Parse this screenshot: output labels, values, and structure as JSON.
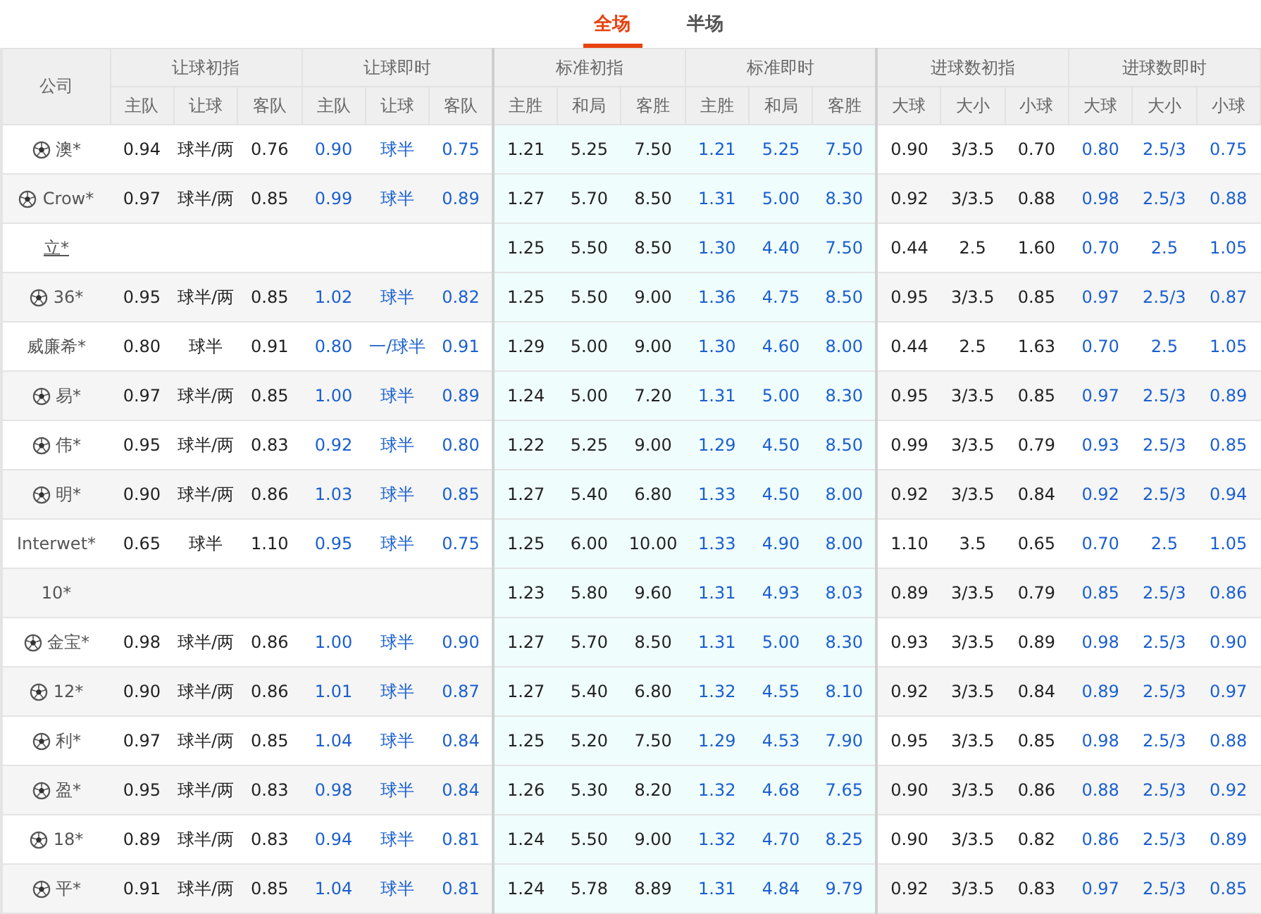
{
  "tabs": [
    {
      "label": "全场",
      "selected": true
    },
    {
      "label": "半场",
      "selected": false
    }
  ],
  "table": {
    "company_header": "公司",
    "groups": [
      {
        "title": "让球初指",
        "live": false,
        "shaded": false,
        "columns": [
          "主队",
          "让球",
          "客队"
        ]
      },
      {
        "title": "让球即时",
        "live": true,
        "shaded": false,
        "columns": [
          "主队",
          "让球",
          "客队"
        ]
      },
      {
        "title": "标准初指",
        "live": false,
        "shaded": true,
        "columns": [
          "主胜",
          "和局",
          "客胜"
        ]
      },
      {
        "title": "标准即时",
        "live": true,
        "shaded": true,
        "columns": [
          "主胜",
          "和局",
          "客胜"
        ]
      },
      {
        "title": "进球数初指",
        "live": false,
        "shaded": false,
        "columns": [
          "大球",
          "大小",
          "小球"
        ]
      },
      {
        "title": "进球数即时",
        "live": true,
        "shaded": false,
        "columns": [
          "大球",
          "大小",
          "小球"
        ]
      }
    ],
    "rows": [
      {
        "company": "澳*",
        "ball": true,
        "link": false,
        "handicap_open": [
          "0.94",
          "球半/两",
          "0.76"
        ],
        "handicap_live": [
          "0.90",
          "球半",
          "0.75"
        ],
        "standard_open": [
          "1.21",
          "5.25",
          "7.50"
        ],
        "standard_live": [
          "1.21",
          "5.25",
          "7.50"
        ],
        "goals_open": [
          "0.90",
          "3/3.5",
          "0.70"
        ],
        "goals_live": [
          "0.80",
          "2.5/3",
          "0.75"
        ]
      },
      {
        "company": "Crow*",
        "ball": true,
        "link": false,
        "handicap_open": [
          "0.97",
          "球半/两",
          "0.85"
        ],
        "handicap_live": [
          "0.99",
          "球半",
          "0.89"
        ],
        "standard_open": [
          "1.27",
          "5.70",
          "8.50"
        ],
        "standard_live": [
          "1.31",
          "5.00",
          "8.30"
        ],
        "goals_open": [
          "0.92",
          "3/3.5",
          "0.88"
        ],
        "goals_live": [
          "0.98",
          "2.5/3",
          "0.88"
        ]
      },
      {
        "company": "立*",
        "ball": false,
        "link": true,
        "standard_open": [
          "1.25",
          "5.50",
          "8.50"
        ],
        "standard_live": [
          "1.30",
          "4.40",
          "7.50"
        ],
        "goals_open": [
          "0.44",
          "2.5",
          "1.60"
        ],
        "goals_live": [
          "0.70",
          "2.5",
          "1.05"
        ]
      },
      {
        "company": "36*",
        "ball": true,
        "link": false,
        "handicap_open": [
          "0.95",
          "球半/两",
          "0.85"
        ],
        "handicap_live": [
          "1.02",
          "球半",
          "0.82"
        ],
        "standard_open": [
          "1.25",
          "5.50",
          "9.00"
        ],
        "standard_live": [
          "1.36",
          "4.75",
          "8.50"
        ],
        "goals_open": [
          "0.95",
          "3/3.5",
          "0.85"
        ],
        "goals_live": [
          "0.97",
          "2.5/3",
          "0.87"
        ]
      },
      {
        "company": "威廉希*",
        "ball": false,
        "link": false,
        "handicap_open": [
          "0.80",
          "球半",
          "0.91"
        ],
        "handicap_live": [
          "0.80",
          "一/球半",
          "0.91"
        ],
        "standard_open": [
          "1.29",
          "5.00",
          "9.00"
        ],
        "standard_live": [
          "1.30",
          "4.60",
          "8.00"
        ],
        "goals_open": [
          "0.44",
          "2.5",
          "1.63"
        ],
        "goals_live": [
          "0.70",
          "2.5",
          "1.05"
        ]
      },
      {
        "company": "易*",
        "ball": true,
        "link": false,
        "handicap_open": [
          "0.97",
          "球半/两",
          "0.85"
        ],
        "handicap_live": [
          "1.00",
          "球半",
          "0.89"
        ],
        "standard_open": [
          "1.24",
          "5.00",
          "7.20"
        ],
        "standard_live": [
          "1.31",
          "5.00",
          "8.30"
        ],
        "goals_open": [
          "0.95",
          "3/3.5",
          "0.85"
        ],
        "goals_live": [
          "0.97",
          "2.5/3",
          "0.89"
        ]
      },
      {
        "company": "伟*",
        "ball": true,
        "link": false,
        "handicap_open": [
          "0.95",
          "球半/两",
          "0.83"
        ],
        "handicap_live": [
          "0.92",
          "球半",
          "0.80"
        ],
        "standard_open": [
          "1.22",
          "5.25",
          "9.00"
        ],
        "standard_live": [
          "1.29",
          "4.50",
          "8.50"
        ],
        "goals_open": [
          "0.99",
          "3/3.5",
          "0.79"
        ],
        "goals_live": [
          "0.93",
          "2.5/3",
          "0.85"
        ]
      },
      {
        "company": "明*",
        "ball": true,
        "link": false,
        "handicap_open": [
          "0.90",
          "球半/两",
          "0.86"
        ],
        "handicap_live": [
          "1.03",
          "球半",
          "0.85"
        ],
        "standard_open": [
          "1.27",
          "5.40",
          "6.80"
        ],
        "standard_live": [
          "1.33",
          "4.50",
          "8.00"
        ],
        "goals_open": [
          "0.92",
          "3/3.5",
          "0.84"
        ],
        "goals_live": [
          "0.92",
          "2.5/3",
          "0.94"
        ]
      },
      {
        "company": "Interwet*",
        "ball": false,
        "link": false,
        "handicap_open": [
          "0.65",
          "球半",
          "1.10"
        ],
        "handicap_live": [
          "0.95",
          "球半",
          "0.75"
        ],
        "standard_open": [
          "1.25",
          "6.00",
          "10.00"
        ],
        "standard_live": [
          "1.33",
          "4.90",
          "8.00"
        ],
        "goals_open": [
          "1.10",
          "3.5",
          "0.65"
        ],
        "goals_live": [
          "0.70",
          "2.5",
          "1.05"
        ]
      },
      {
        "company": "10*",
        "ball": false,
        "link": false,
        "standard_open": [
          "1.23",
          "5.80",
          "9.60"
        ],
        "standard_live": [
          "1.31",
          "4.93",
          "8.03"
        ],
        "goals_open": [
          "0.89",
          "3/3.5",
          "0.79"
        ],
        "goals_live": [
          "0.85",
          "2.5/3",
          "0.86"
        ]
      },
      {
        "company": "金宝*",
        "ball": true,
        "link": false,
        "handicap_open": [
          "0.98",
          "球半/两",
          "0.86"
        ],
        "handicap_live": [
          "1.00",
          "球半",
          "0.90"
        ],
        "standard_open": [
          "1.27",
          "5.70",
          "8.50"
        ],
        "standard_live": [
          "1.31",
          "5.00",
          "8.30"
        ],
        "goals_open": [
          "0.93",
          "3/3.5",
          "0.89"
        ],
        "goals_live": [
          "0.98",
          "2.5/3",
          "0.90"
        ]
      },
      {
        "company": "12*",
        "ball": true,
        "link": false,
        "handicap_open": [
          "0.90",
          "球半/两",
          "0.86"
        ],
        "handicap_live": [
          "1.01",
          "球半",
          "0.87"
        ],
        "standard_open": [
          "1.27",
          "5.40",
          "6.80"
        ],
        "standard_live": [
          "1.32",
          "4.55",
          "8.10"
        ],
        "goals_open": [
          "0.92",
          "3/3.5",
          "0.84"
        ],
        "goals_live": [
          "0.89",
          "2.5/3",
          "0.97"
        ]
      },
      {
        "company": "利*",
        "ball": true,
        "link": false,
        "handicap_open": [
          "0.97",
          "球半/两",
          "0.85"
        ],
        "handicap_live": [
          "1.04",
          "球半",
          "0.84"
        ],
        "standard_open": [
          "1.25",
          "5.20",
          "7.50"
        ],
        "standard_live": [
          "1.29",
          "4.53",
          "7.90"
        ],
        "goals_open": [
          "0.95",
          "3/3.5",
          "0.85"
        ],
        "goals_live": [
          "0.98",
          "2.5/3",
          "0.88"
        ]
      },
      {
        "company": "盈*",
        "ball": true,
        "link": false,
        "handicap_open": [
          "0.95",
          "球半/两",
          "0.83"
        ],
        "handicap_live": [
          "0.98",
          "球半",
          "0.84"
        ],
        "standard_open": [
          "1.26",
          "5.30",
          "8.20"
        ],
        "standard_live": [
          "1.32",
          "4.68",
          "7.65"
        ],
        "goals_open": [
          "0.90",
          "3/3.5",
          "0.86"
        ],
        "goals_live": [
          "0.88",
          "2.5/3",
          "0.92"
        ]
      },
      {
        "company": "18*",
        "ball": true,
        "link": false,
        "handicap_open": [
          "0.89",
          "球半/两",
          "0.83"
        ],
        "handicap_live": [
          "0.94",
          "球半",
          "0.81"
        ],
        "standard_open": [
          "1.24",
          "5.50",
          "9.00"
        ],
        "standard_live": [
          "1.32",
          "4.70",
          "8.25"
        ],
        "goals_open": [
          "0.90",
          "3/3.5",
          "0.82"
        ],
        "goals_live": [
          "0.86",
          "2.5/3",
          "0.89"
        ]
      },
      {
        "company": "平*",
        "ball": true,
        "link": false,
        "handicap_open": [
          "0.91",
          "球半/两",
          "0.85"
        ],
        "handicap_live": [
          "1.04",
          "球半",
          "0.81"
        ],
        "standard_open": [
          "1.24",
          "5.78",
          "8.89"
        ],
        "standard_live": [
          "1.31",
          "4.84",
          "9.79"
        ],
        "goals_open": [
          "0.92",
          "3/3.5",
          "0.83"
        ],
        "goals_live": [
          "0.97",
          "2.5/3",
          "0.85"
        ]
      }
    ]
  }
}
